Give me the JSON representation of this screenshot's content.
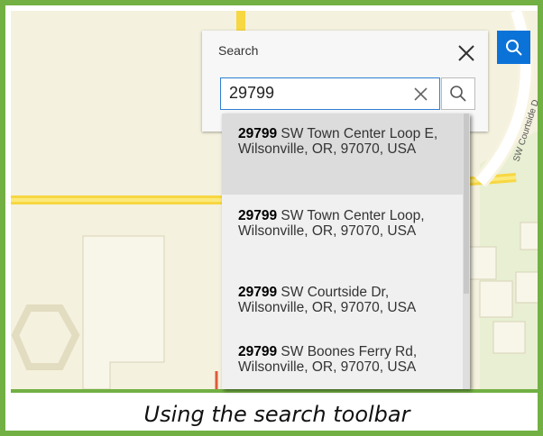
{
  "caption": "Using the search toolbar",
  "map": {
    "street_label": "SW Courtside D"
  },
  "search_panel": {
    "title": "Search",
    "close_icon": "close-icon",
    "input": {
      "value": "29799",
      "clear_icon": "clear-icon"
    },
    "search_icon": "search-icon"
  },
  "search_toggle_icon": "search-icon",
  "results": [
    {
      "match": "29799",
      "rest": " SW Town Center Loop E, Wilsonville, OR, 97070, USA"
    },
    {
      "match": "29799",
      "rest": " SW Town Center Loop, Wilsonville, OR, 97070, USA"
    },
    {
      "match": "29799",
      "rest": " SW Courtside Dr, Wilsonville, OR, 97070, USA"
    },
    {
      "match": "29799",
      "rest": " SW Boones Ferry Rd, Wilsonville, OR, 97070, USA"
    }
  ],
  "colors": {
    "frame_border": "#72b043",
    "accent_blue": "#0b72d8",
    "map_background": "#f4f1de",
    "road_yellow": "#f7d742"
  }
}
